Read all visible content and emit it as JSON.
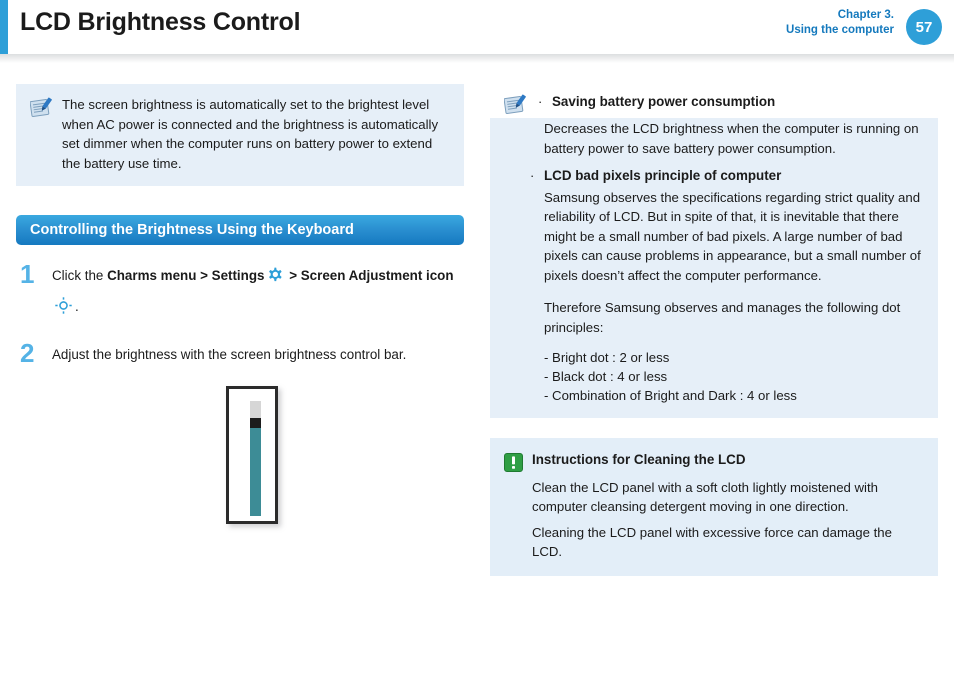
{
  "header": {
    "title": "LCD Brightness Control",
    "chapter_line1": "Chapter 3.",
    "chapter_line2": "Using the computer",
    "page_number": "57",
    "accent_color": "#2e9fd8",
    "chapter_text_color": "#1479bd"
  },
  "left_column": {
    "note": {
      "icon": "notepad-pen-icon",
      "text": "The screen brightness is automatically set to the brightest level when AC power is connected and the brightness is automatically set dimmer when the computer runs on battery power to extend the battery use time."
    },
    "section_heading": "Controlling the Brightness Using the Keyboard",
    "steps": [
      {
        "number": "1",
        "part1": "Click the ",
        "bold1": "Charms menu > Settings",
        "icon1": "gear-icon",
        "bold2": "> Screen Adjustment icon",
        "icon2": "brightness-sun-icon",
        "tail": "."
      },
      {
        "number": "2",
        "text": "Adjust the brightness with the screen brightness control bar."
      }
    ],
    "slider_figure": {
      "name": "screen-brightness-control-bar",
      "fill_color": "#3d8c96",
      "track_color": "#d6d6d6",
      "thumb_color": "#1c1c1c",
      "fill_percent": 76
    }
  },
  "right_column": {
    "note_icon": "notepad-pen-icon",
    "bullets": [
      {
        "marker": "·",
        "title": "Saving battery power consumption",
        "paragraphs": [
          "Decreases the LCD brightness when the computer is running on battery power to save battery power consumption."
        ]
      },
      {
        "marker": "·",
        "title": "LCD bad pixels principle of computer",
        "paragraphs": [
          "Samsung observes the specifications regarding strict quality and reliability of LCD. But in spite of that, it is inevitable that there might be a small number of bad pixels. A large number of bad pixels can cause problems in appearance, but a small number of pixels doesn’t affect the computer performance.",
          "Therefore Samsung observes and manages the following dot principles:"
        ],
        "dot_principles": [
          "- Bright dot : 2 or less",
          "- Black dot  : 4 or less",
          "- Combination of Bright and Dark : 4 or less"
        ]
      }
    ],
    "caution": {
      "icon": "caution-exclamation-icon",
      "icon_color": "#2f9e44",
      "title": "Instructions for Cleaning the LCD",
      "paragraphs": [
        "Clean the LCD panel with a soft cloth lightly moistened with computer cleansing detergent moving in one direction.",
        "Cleaning the LCD panel with excessive force can damage the LCD."
      ]
    }
  }
}
